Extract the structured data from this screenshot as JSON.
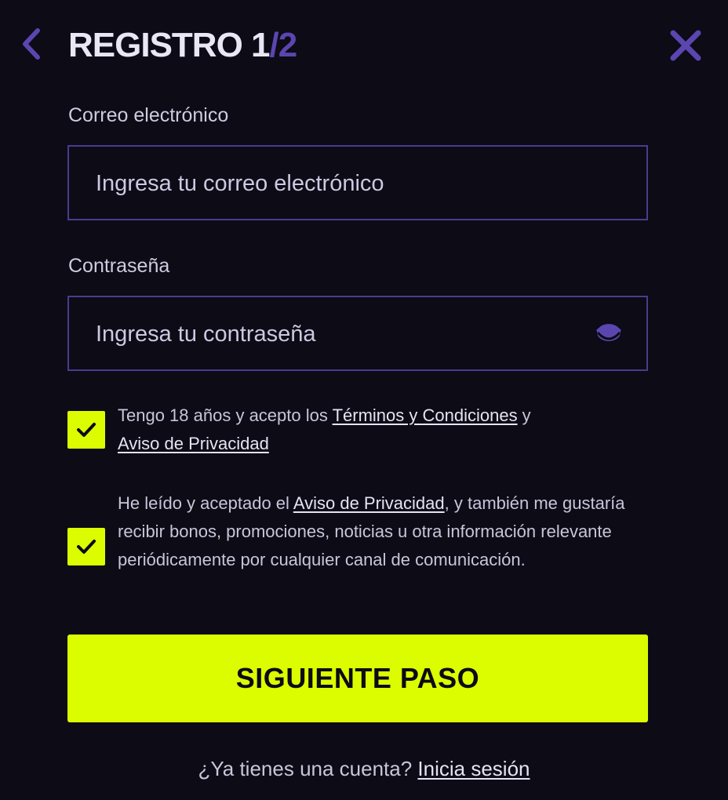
{
  "header": {
    "title_main": "REGISTRO 1",
    "title_sep": "/",
    "title_total": "2",
    "back_icon": "chevron-left-icon",
    "close_icon": "close-icon"
  },
  "email": {
    "label": "Correo electrónico",
    "placeholder": "Ingresa tu correo electrónico",
    "value": ""
  },
  "password": {
    "label": "Contraseña",
    "placeholder": "Ingresa tu contraseña",
    "value": "",
    "toggle_icon": "eye-icon"
  },
  "consent_terms": {
    "checked": true,
    "text_before": "Tengo 18 años y acepto los ",
    "terms_link": "Términos y Condiciones",
    "text_middle": " y ",
    "privacy_link": "Aviso de Privacidad"
  },
  "consent_marketing": {
    "checked": true,
    "text_before": "He leído y aceptado el ",
    "privacy_link": "Aviso de Privacidad",
    "text_after": ", y también me gustaría recibir bonos, promociones, noticias u otra información relevante periódicamente por cualquier canal de comunicación."
  },
  "cta": {
    "label": "SIGUIENTE PASO"
  },
  "footer": {
    "prompt": "¿Ya tienes una cuenta? ",
    "login_link": "Inicia sesión"
  },
  "colors": {
    "background": "#0c0b16",
    "accent": "#dcfd00",
    "purple": "#5b46b0",
    "border": "#4a3c8e"
  }
}
